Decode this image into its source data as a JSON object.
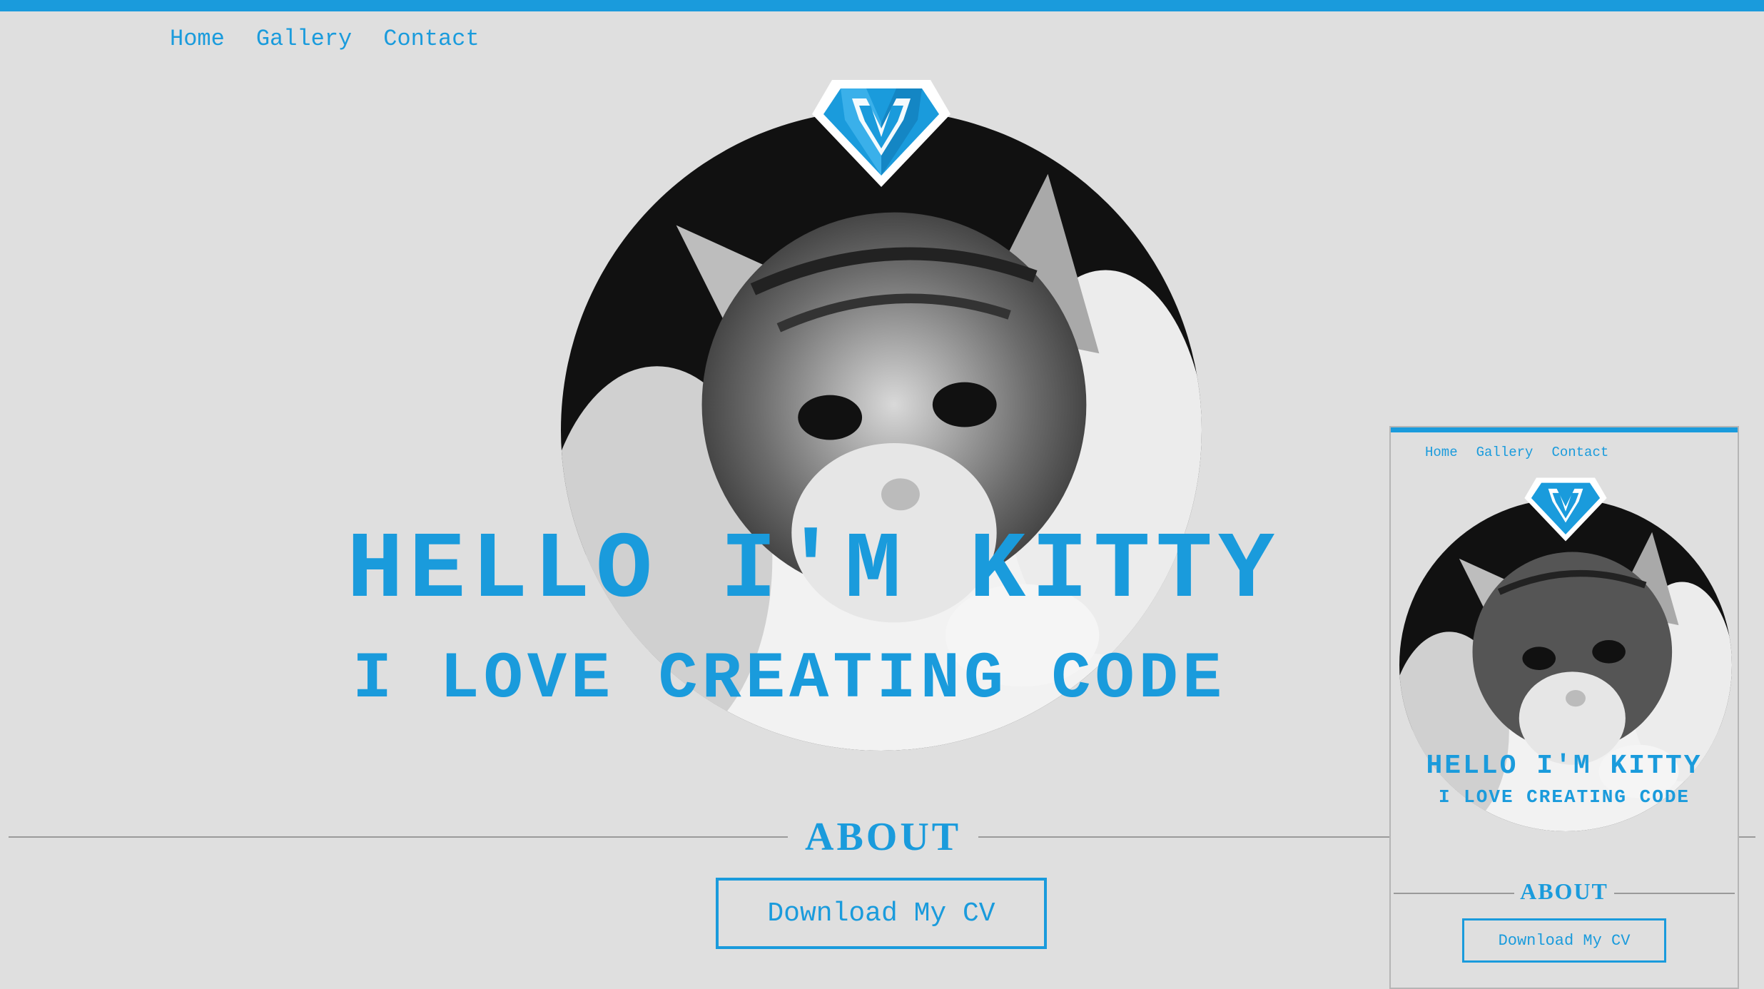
{
  "nav": {
    "items": [
      "Home",
      "Gallery",
      "Contact"
    ]
  },
  "hero": {
    "title": "HELLO I'M KITTY",
    "subtitle": "I LOVE CREATING CODE",
    "photo_icon": "kitten-photo",
    "logo_icon": "diamond-m-logo"
  },
  "about": {
    "title": "ABOUT",
    "button_label": "Download My CV"
  },
  "mobile": {
    "nav": [
      "Home",
      "Gallery",
      "Contact"
    ],
    "title": "HELLO I'M KITTY",
    "subtitle": "I LOVE CREATING CODE",
    "about_title": "ABOUT",
    "button_label": "Download My CV"
  },
  "colors": {
    "accent": "#1a9bdc",
    "background": "#dfdfdf"
  }
}
